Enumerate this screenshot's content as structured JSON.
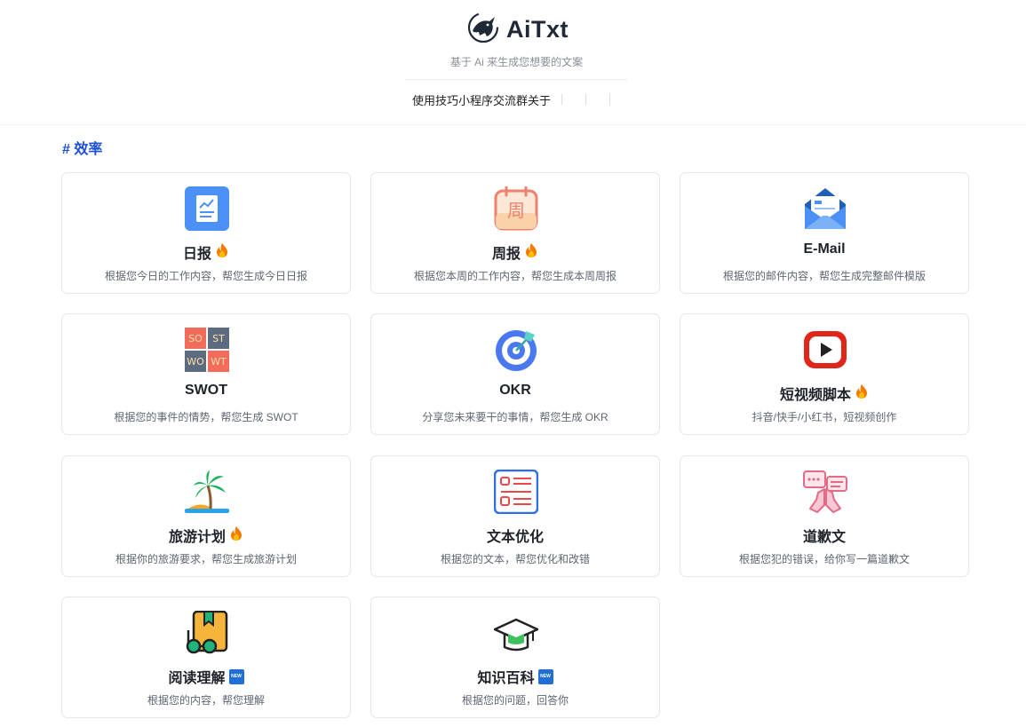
{
  "app": {
    "name": "AiTxt",
    "tagline": "基于 Ai 来生成您想要的文案",
    "nav": [
      "使用技巧",
      "小程序",
      "交流群",
      "关于"
    ]
  },
  "section": {
    "title": "# 效率"
  },
  "cards": [
    {
      "title": "日报",
      "desc": "根据您今日的工作内容，帮您生成今日日报",
      "badge": "fire-icon"
    },
    {
      "title": "周报",
      "desc": "根据您本周的工作内容，帮您生成本周周报",
      "badge": "fire-icon"
    },
    {
      "title": "E-Mail",
      "desc": "根据您的邮件内容，帮您生成完整邮件模版",
      "badge": ""
    },
    {
      "title": "SWOT",
      "desc": "根据您的事件的情势，帮您生成 SWOT",
      "badge": "",
      "icon_text": [
        "SO",
        "ST",
        "WO",
        "WT"
      ]
    },
    {
      "title": "OKR",
      "desc": "分享您未来要干的事情，帮您生成 OKR",
      "badge": ""
    },
    {
      "title": "短视频脚本",
      "desc": "抖音/快手/小红书，短视频创作",
      "badge": "fire-icon"
    },
    {
      "title": "旅游计划",
      "desc": "根据你的旅游要求，帮您生成旅游计划",
      "badge": "fire-icon"
    },
    {
      "title": "文本优化",
      "desc": "根据您的文本，帮您优化和改错",
      "badge": ""
    },
    {
      "title": "道歉文",
      "desc": "根据您犯的错误，给你写一篇道歉文",
      "badge": ""
    },
    {
      "title": "阅读理解",
      "desc": "根据您的内容，帮您理解",
      "badge": "new-icon",
      "badge_text": "NEW"
    },
    {
      "title": "知识百科",
      "desc": "根据您的问题，回答你",
      "badge": "new-icon",
      "badge_text": "NEW"
    }
  ],
  "calendar_char": "周",
  "colors": {
    "accent": "#1b4fd8",
    "fire": "#f57c00"
  }
}
